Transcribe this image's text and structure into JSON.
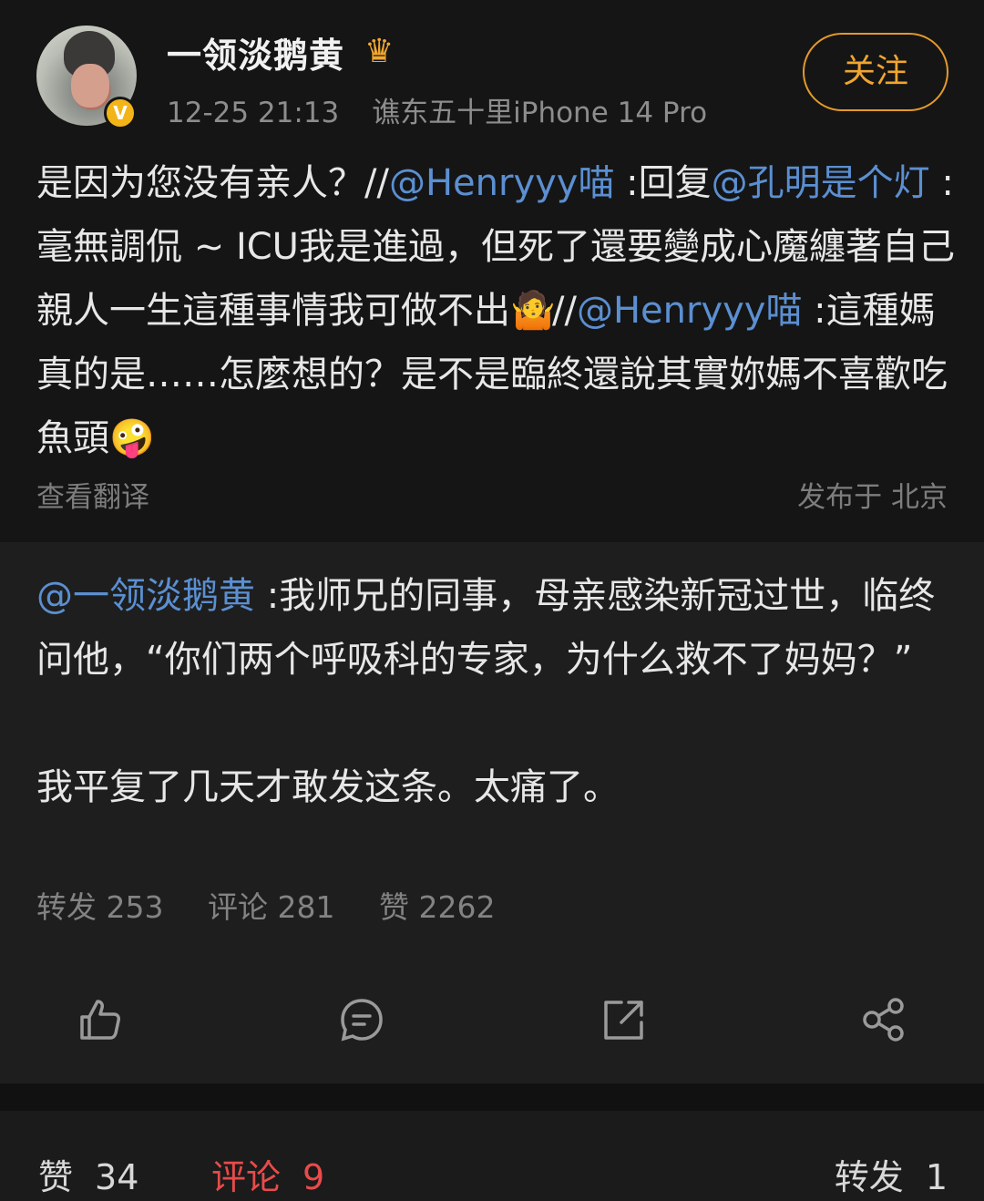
{
  "header": {
    "username": "一领淡鹅黄",
    "crown_icon": "crown-icon",
    "verified_badge": "V",
    "time": "12-25 21:13",
    "device": "谯东五十里iPhone 14 Pro",
    "follow_label": "关注"
  },
  "comment": {
    "text_1": "是因为您没有亲人？//",
    "mention_1": "@Henryyy喵",
    "text_2": " :回复",
    "mention_2": "@孔明是个灯",
    "text_3": " :毫無調侃 ~ ICU我是進過，但死了還要變成心魔纏著自己親人一生這種事情我可做不出",
    "emoji_1": "🤷",
    "text_4": "//",
    "mention_3": "@Henryyy喵",
    "text_5": " :這種媽真的是……怎麼想的？是不是臨終還說其實妳媽不喜歡吃魚頭",
    "emoji_2": "🤪",
    "translate": "查看翻译",
    "location": "发布于 北京"
  },
  "repost": {
    "mention": "@一领淡鹅黄",
    "text": " :我师兄的同事，母亲感染新冠过世，临终问他，“你们两个呼吸科的专家，为什么救不了妈妈？”",
    "last_line": "我平复了几天才敢发这条。太痛了。",
    "stats": {
      "repost": "转发 253",
      "comment": "评论 281",
      "like": "赞 2262"
    }
  },
  "actions": [
    "thumbs-up-icon",
    "comment-icon",
    "share-external-icon",
    "share-nodes-icon"
  ],
  "bottom": {
    "like_label": "赞",
    "like_count": "34",
    "comment_label": "评论",
    "comment_count": "9",
    "repost_label": "转发",
    "repost_count": "1"
  },
  "colors": {
    "background": "#151515",
    "link": "#5b8fd1",
    "follow": "#e39a2a",
    "active_tab": "#e84b4b"
  }
}
